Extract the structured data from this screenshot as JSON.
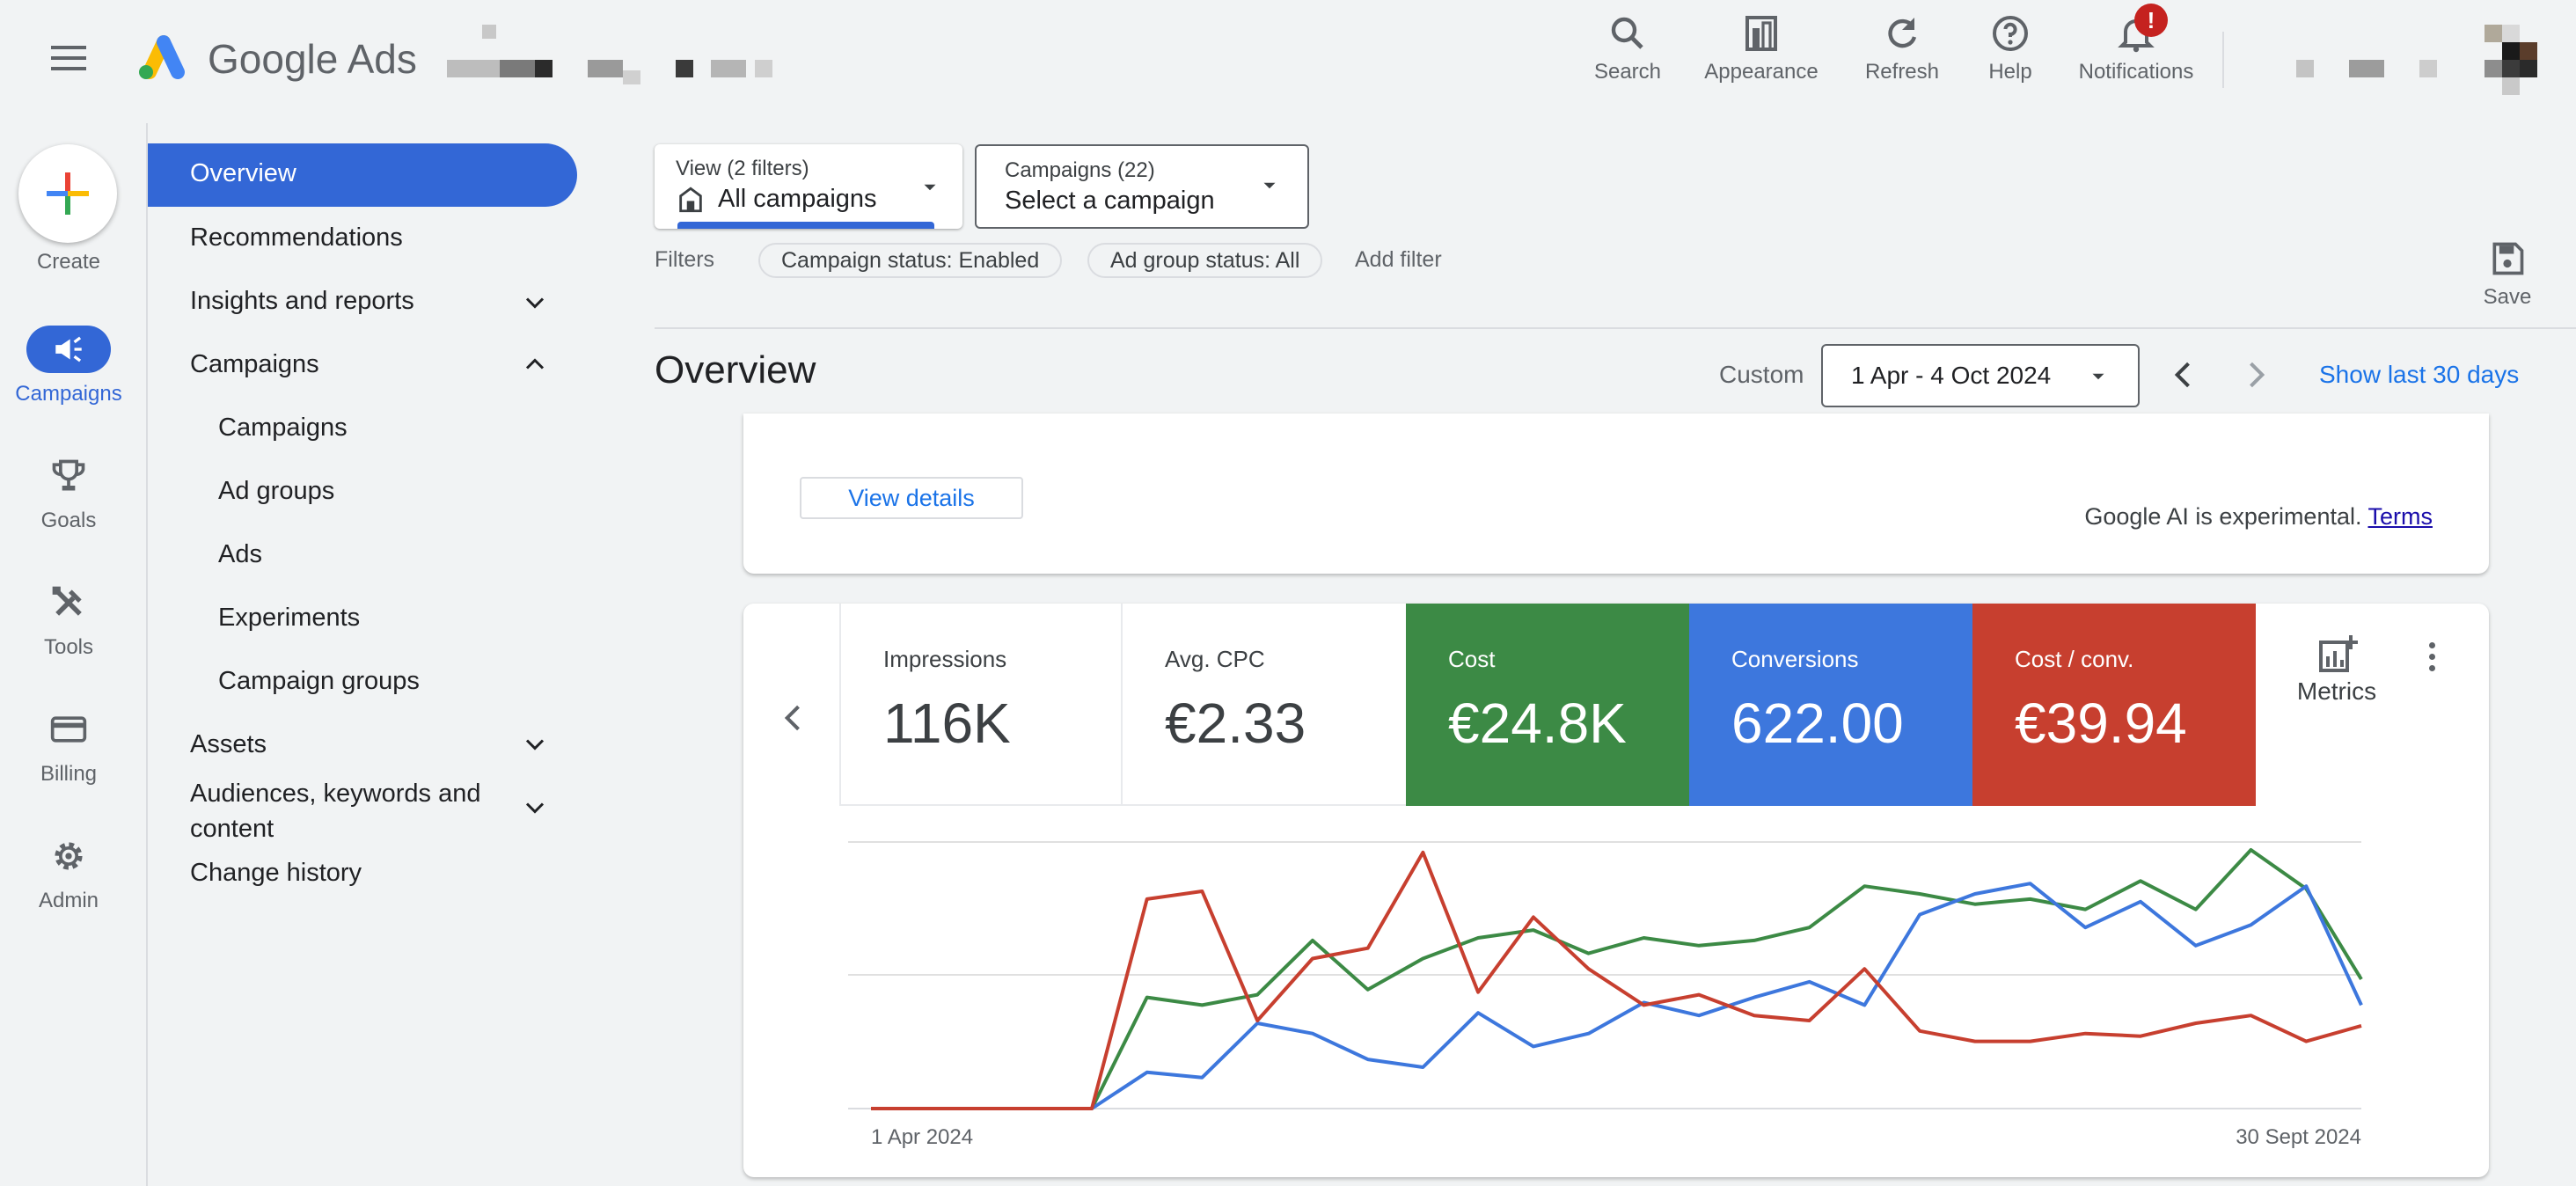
{
  "header": {
    "brand": "Google Ads",
    "buttons": [
      {
        "label": "Search",
        "icon": "search-icon"
      },
      {
        "label": "Appearance",
        "icon": "appearance-icon"
      },
      {
        "label": "Refresh",
        "icon": "refresh-icon"
      },
      {
        "label": "Help",
        "icon": "help-icon"
      },
      {
        "label": "Notifications",
        "icon": "bell-icon"
      }
    ],
    "notification_badge": "!"
  },
  "rail": {
    "create": "Create",
    "items": [
      {
        "label": "Campaigns",
        "icon": "megaphone-icon",
        "active": true
      },
      {
        "label": "Goals",
        "icon": "trophy-icon"
      },
      {
        "label": "Tools",
        "icon": "tools-icon"
      },
      {
        "label": "Billing",
        "icon": "billing-icon"
      },
      {
        "label": "Admin",
        "icon": "gear-icon"
      }
    ]
  },
  "nav": {
    "overview": "Overview",
    "recommendations": "Recommendations",
    "insights": "Insights and reports",
    "campaigns_group": "Campaigns",
    "campaigns": "Campaigns",
    "ad_groups": "Ad groups",
    "ads": "Ads",
    "experiments": "Experiments",
    "campaign_groups": "Campaign groups",
    "assets": "Assets",
    "audiences_line1": "Audiences, keywords and",
    "audiences_line2": "content",
    "change_history": "Change history"
  },
  "filters": {
    "view_caption": "View (2 filters)",
    "view_value": "All campaigns",
    "campaigns_caption": "Campaigns (22)",
    "campaigns_value": "Select a campaign",
    "filters_label": "Filters",
    "chip_campaign_status": "Campaign status: Enabled",
    "chip_ad_group_status": "Ad group status: All",
    "add_filter": "Add filter",
    "save": "Save"
  },
  "overview": {
    "title": "Overview",
    "date_mode": "Custom",
    "date_range": "1 Apr - 4 Oct 2024",
    "show_last": "Show last 30 days"
  },
  "ai_card": {
    "view_details": "View details",
    "disclaimer": "Google AI is experimental.",
    "terms": "Terms"
  },
  "metrics": {
    "cards": [
      {
        "label": "Impressions",
        "value": "116K",
        "color": "#ffffff",
        "text_color": "#202124"
      },
      {
        "label": "Avg. CPC",
        "value": "€2.33",
        "color": "#ffffff",
        "text_color": "#202124"
      },
      {
        "label": "Cost",
        "value": "€24.8K",
        "color": "#3c8a45",
        "text_color": "#ffffff"
      },
      {
        "label": "Conversions",
        "value": "622.00",
        "color": "#3d77dd",
        "text_color": "#ffffff"
      },
      {
        "label": "Cost / conv.",
        "value": "€39.94",
        "color": "#c73f2f",
        "text_color": "#ffffff"
      }
    ],
    "metrics_button": "Metrics"
  },
  "chart_data": {
    "type": "line",
    "x_start_label": "1 Apr 2024",
    "x_end_label": "30 Sept 2024",
    "gridlines": true,
    "series": [
      {
        "metric": "Cost",
        "color": "#3c8a45",
        "values": [
          0,
          0,
          0,
          0,
          0,
          0.43,
          0.4,
          0.44,
          0.65,
          0.46,
          0.58,
          0.66,
          0.69,
          0.6,
          0.66,
          0.63,
          0.65,
          0.7,
          0.86,
          0.83,
          0.79,
          0.81,
          0.77,
          0.88,
          0.77,
          1.0,
          0.85,
          0.5
        ]
      },
      {
        "metric": "Conversions",
        "color": "#3d77dd",
        "values": [
          0,
          0,
          0,
          0,
          0,
          0.14,
          0.12,
          0.33,
          0.29,
          0.19,
          0.16,
          0.37,
          0.24,
          0.29,
          0.41,
          0.36,
          0.43,
          0.49,
          0.4,
          0.75,
          0.83,
          0.87,
          0.7,
          0.8,
          0.63,
          0.71,
          0.86,
          0.4
        ]
      },
      {
        "metric": "Cost / conv.",
        "color": "#c73f2f",
        "values": [
          0,
          0,
          0,
          0,
          0,
          0.81,
          0.84,
          0.34,
          0.58,
          0.62,
          0.99,
          0.45,
          0.74,
          0.54,
          0.4,
          0.44,
          0.36,
          0.34,
          0.54,
          0.3,
          0.26,
          0.26,
          0.29,
          0.28,
          0.33,
          0.36,
          0.26,
          0.32
        ]
      }
    ]
  }
}
